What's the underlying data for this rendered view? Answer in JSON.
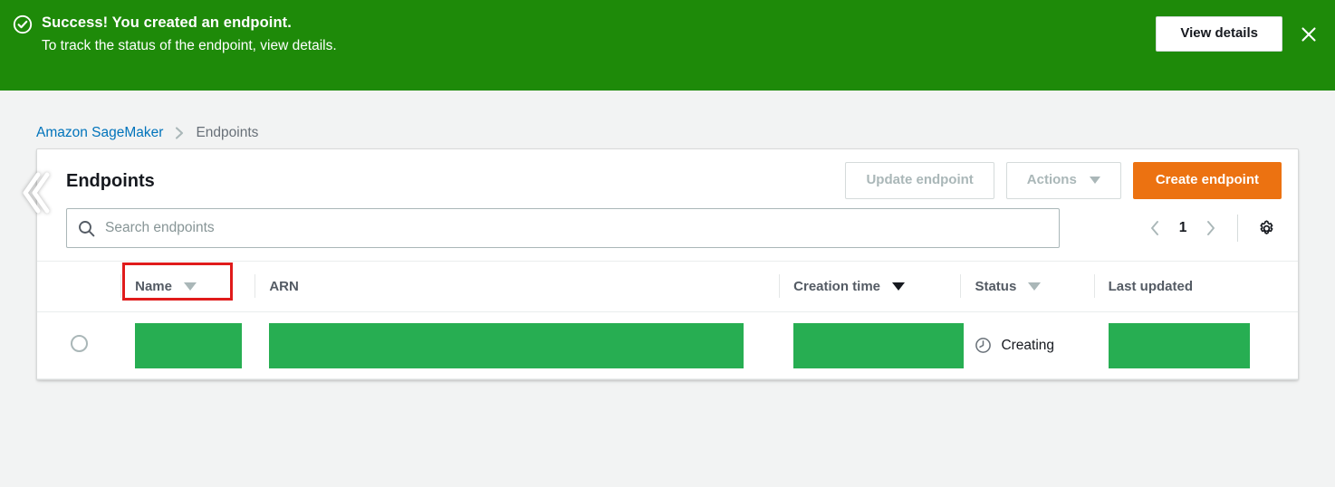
{
  "flash": {
    "icon": "circle-check-icon",
    "title": "Success! You created an endpoint.",
    "subtitle": "To track the status of the endpoint, view details.",
    "view_details_label": "View details",
    "close_icon": "close-icon",
    "background_color": "#1e8a09"
  },
  "breadcrumb": {
    "root_label": "Amazon SageMaker",
    "separator_icon": "chevron-right-icon",
    "current_label": "Endpoints"
  },
  "panel": {
    "collapse_icon": "double-chevron-left-icon",
    "title": "Endpoints",
    "buttons": {
      "update_label": "Update endpoint",
      "actions_label": "Actions",
      "actions_caret_icon": "caret-down-icon",
      "create_label": "Create endpoint",
      "create_color": "#ec7211"
    },
    "search": {
      "icon": "search-icon",
      "value": "",
      "placeholder": "Search endpoints"
    },
    "pagination": {
      "prev_icon": "chevron-left-icon",
      "page": "1",
      "next_icon": "chevron-right-icon",
      "settings_icon": "gear-icon"
    }
  },
  "table": {
    "columns": [
      {
        "label": "Name",
        "sortable": true,
        "sort_active": false,
        "highlighted": true
      },
      {
        "label": "ARN",
        "sortable": false,
        "sort_active": false,
        "highlighted": false
      },
      {
        "label": "Creation time",
        "sortable": true,
        "sort_active": true,
        "highlighted": false
      },
      {
        "label": "Status",
        "sortable": true,
        "sort_active": false,
        "highlighted": false
      },
      {
        "label": "Last updated",
        "sortable": false,
        "sort_active": false,
        "highlighted": false
      }
    ],
    "rows": [
      {
        "selected": false,
        "name": "",
        "arn": "",
        "creation_time": "",
        "status": "Creating",
        "status_icon": "clock-icon",
        "last_updated": "",
        "redacted_color": "#27ae52"
      }
    ]
  }
}
